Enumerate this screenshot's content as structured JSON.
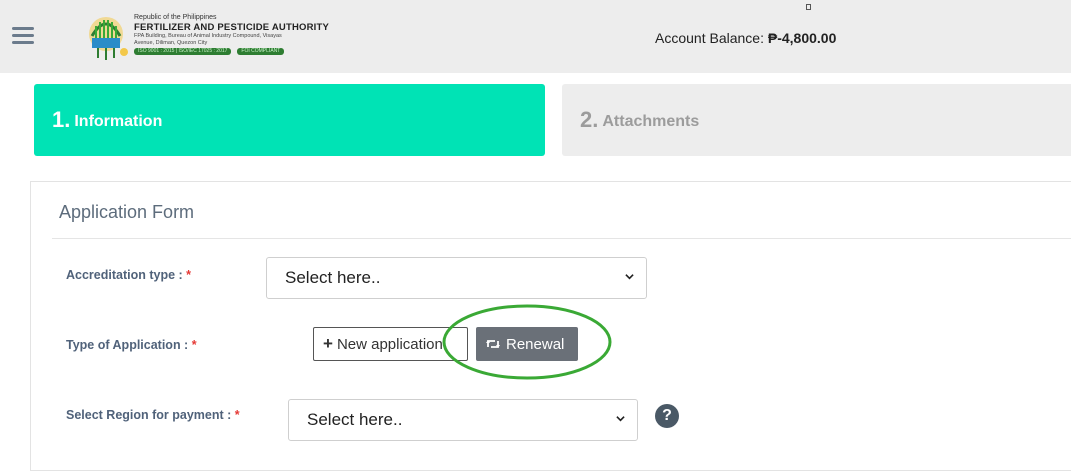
{
  "header": {
    "org_line1": "Republic of the Philippines",
    "org_name": "FERTILIZER AND PESTICIDE AUTHORITY",
    "org_address1": "FPA Building, Bureau of Animal Industry Compound, Visayas",
    "org_address2": "Avenue, Diliman, Quezon City",
    "badge_iso": "ISO 9001 : 2015 | ISO/IEC 17025 : 2017",
    "badge_foi": "FOI COMPLIANT",
    "balance_label": "Account Balance:",
    "balance_value": "₱-4,800.00"
  },
  "steps": [
    {
      "num": "1.",
      "label": "Information"
    },
    {
      "num": "2.",
      "label": "Attachments"
    }
  ],
  "form": {
    "title": "Application Form",
    "accreditation_label": "Accreditation type :",
    "accreditation_placeholder": "Select here..",
    "application_type_label": "Type of Application :",
    "new_application_label": "New application",
    "renewal_label": "Renewal",
    "region_label": "Select Region for payment :",
    "region_placeholder": "Select here..",
    "required_mark": "*",
    "help_glyph": "?"
  },
  "colors": {
    "active_step": "#00e3b5",
    "inactive_step": "#ededed",
    "renewal_button": "#6a7078",
    "highlight_circle": "#3aa935",
    "required": "#e53935"
  }
}
